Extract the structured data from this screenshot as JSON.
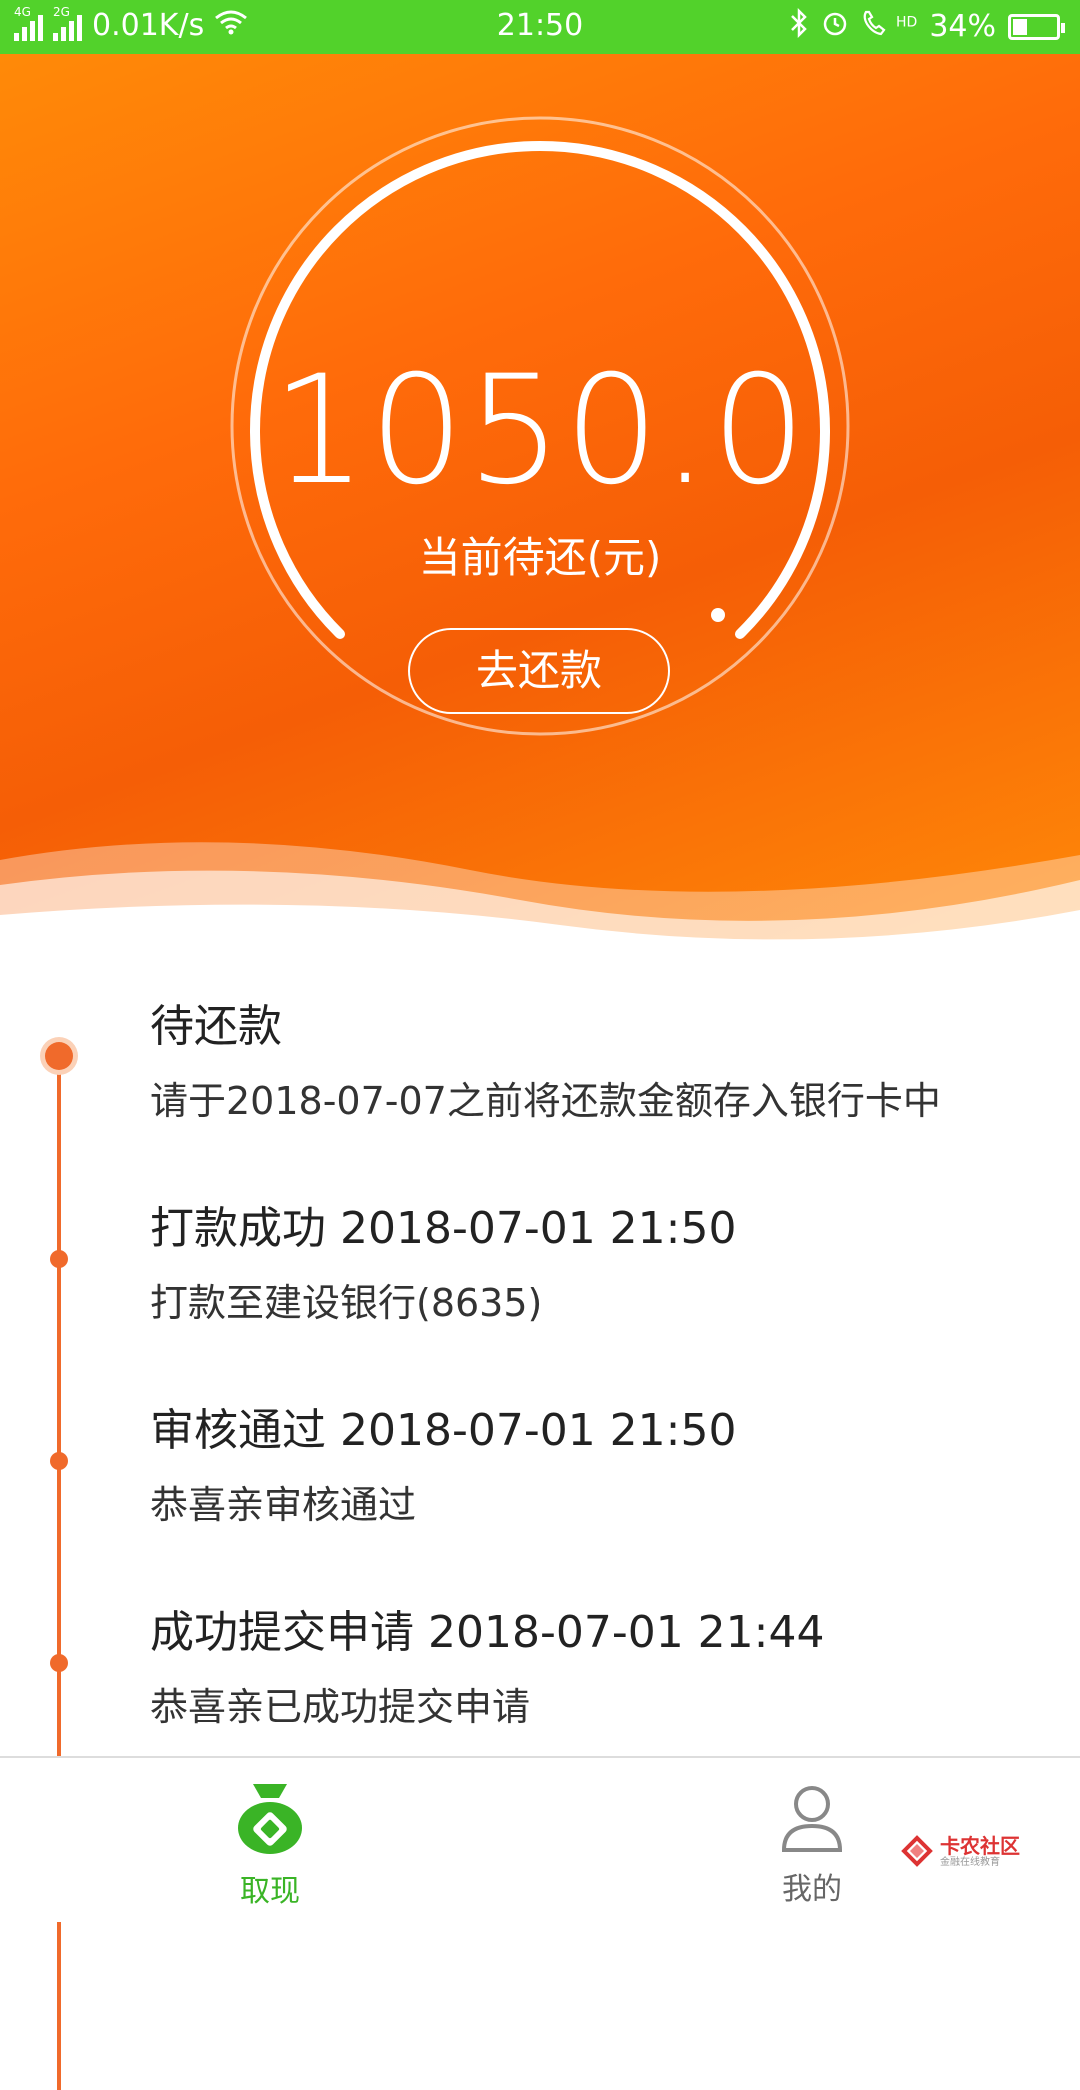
{
  "status_bar": {
    "net_label_1": "4G",
    "net_label_2": "2G",
    "speed": "0.01K/s",
    "time": "21:50",
    "hd_label": "HD",
    "battery": "34%",
    "battery_level": 0.34
  },
  "hero": {
    "amount": "1050.0",
    "amount_label": "当前待还(元)",
    "repay_button": "去还款"
  },
  "timeline": {
    "items": [
      {
        "title": "待还款",
        "desc": "请于2018-07-07之前将还款金额存入银行卡中"
      },
      {
        "title": "打款成功 2018-07-01 21:50",
        "desc": "打款至建设银行(8635)"
      },
      {
        "title": "审核通过 2018-07-01 21:50",
        "desc": "恭喜亲审核通过"
      },
      {
        "title": "成功提交申请 2018-07-01 21:44",
        "desc": "恭喜亲已成功提交申请"
      }
    ]
  },
  "nav": {
    "cash_label": "取现",
    "mine_label": "我的"
  },
  "watermark": {
    "name": "卡农社区",
    "sub": "金融在线教育"
  },
  "colors": {
    "status_bar": "#52d22b",
    "hero_orange": "#ff6b0a",
    "timeline_accent": "#f06a2b",
    "nav_active": "#3ab426"
  }
}
